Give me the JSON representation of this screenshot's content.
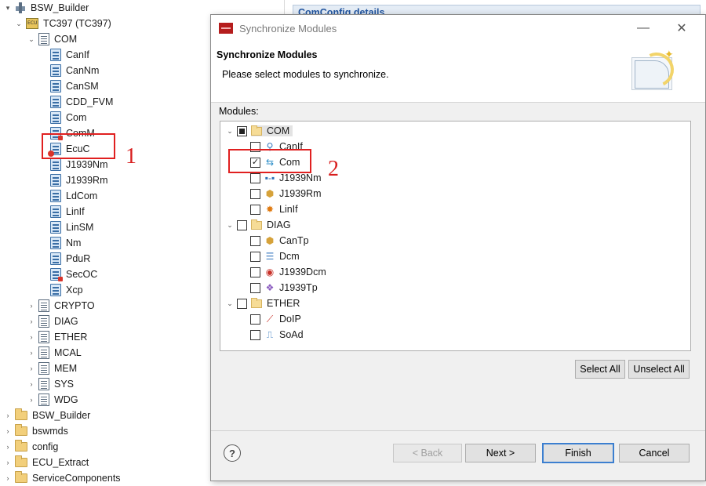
{
  "tree": {
    "items": [
      {
        "label": "BSW_Builder",
        "icon": "project-icon",
        "expanded": true
      },
      {
        "label": "TC397 (TC397)",
        "icon": "ecu-icon",
        "expanded": true
      },
      {
        "label": "COM",
        "icon": "module-list-icon",
        "expanded": true
      },
      {
        "label": "CanIf",
        "icon": "module-file-icon"
      },
      {
        "label": "CanNm",
        "icon": "module-file-icon"
      },
      {
        "label": "CanSM",
        "icon": "module-file-icon"
      },
      {
        "label": "CDD_FVM",
        "icon": "module-file-icon"
      },
      {
        "label": "Com",
        "icon": "module-file-icon"
      },
      {
        "label": "ComM",
        "icon": "module-file-icon"
      },
      {
        "label": "EcuC",
        "icon": "module-file-icon"
      },
      {
        "label": "J1939Nm",
        "icon": "module-file-icon"
      },
      {
        "label": "J1939Rm",
        "icon": "module-file-icon"
      },
      {
        "label": "LdCom",
        "icon": "module-file-icon"
      },
      {
        "label": "LinIf",
        "icon": "module-file-icon"
      },
      {
        "label": "LinSM",
        "icon": "module-file-icon"
      },
      {
        "label": "Nm",
        "icon": "module-file-icon"
      },
      {
        "label": "PduR",
        "icon": "module-file-icon"
      },
      {
        "label": "SecOC",
        "icon": "module-file-icon"
      },
      {
        "label": "Xcp",
        "icon": "module-file-icon"
      },
      {
        "label": "CRYPTO",
        "icon": "module-list-icon"
      },
      {
        "label": "DIAG",
        "icon": "module-list-icon"
      },
      {
        "label": "ETHER",
        "icon": "module-list-icon"
      },
      {
        "label": "MCAL",
        "icon": "module-list-icon"
      },
      {
        "label": "MEM",
        "icon": "module-list-icon"
      },
      {
        "label": "SYS",
        "icon": "module-list-icon"
      },
      {
        "label": "WDG",
        "icon": "module-list-icon"
      },
      {
        "label": "BSW_Builder",
        "icon": "folder-icon"
      },
      {
        "label": "bswmds",
        "icon": "folder-icon"
      },
      {
        "label": "config",
        "icon": "folder-icon"
      },
      {
        "label": "ECU_Extract",
        "icon": "folder-icon"
      },
      {
        "label": "ServiceComponents",
        "icon": "folder-icon"
      }
    ]
  },
  "annotations": {
    "one": "1",
    "two": "2"
  },
  "background_editor": {
    "title": "ComConfig details"
  },
  "dialog": {
    "window_title": "Synchronize Modules",
    "header_title": "Synchronize Modules",
    "header_subtitle": "Please select modules to synchronize.",
    "modules_label": "Modules:",
    "groups": [
      {
        "label": "COM",
        "state": "partial",
        "items": [
          {
            "label": "CanIf",
            "checked": false,
            "icon": "network-icon"
          },
          {
            "label": "Com",
            "checked": true,
            "icon": "com-icon"
          },
          {
            "label": "J1939Nm",
            "checked": false,
            "icon": "node-link-icon"
          },
          {
            "label": "J1939Rm",
            "checked": false,
            "icon": "package-icon"
          },
          {
            "label": "LinIf",
            "checked": false,
            "icon": "spark-icon"
          }
        ]
      },
      {
        "label": "DIAG",
        "state": "unchecked",
        "items": [
          {
            "label": "CanTp",
            "checked": false,
            "icon": "package-icon"
          },
          {
            "label": "Dcm",
            "checked": false,
            "icon": "database-icon"
          },
          {
            "label": "J1939Dcm",
            "checked": false,
            "icon": "target-icon"
          },
          {
            "label": "J1939Tp",
            "checked": false,
            "icon": "molecule-icon"
          }
        ]
      },
      {
        "label": "ETHER",
        "state": "unchecked",
        "items": [
          {
            "label": "DoIP",
            "checked": false,
            "icon": "chart-link-icon"
          },
          {
            "label": "SoAd",
            "checked": false,
            "icon": "socket-icon"
          }
        ]
      }
    ],
    "buttons": {
      "select_all": "Select All",
      "unselect_all": "Unselect All",
      "back": "< Back",
      "next": "Next >",
      "finish": "Finish",
      "cancel": "Cancel",
      "help": "?"
    },
    "window_controls": {
      "minimize": "—",
      "maximize": "☐",
      "close": "✕"
    }
  },
  "colors": {
    "highlight": "#e02020",
    "accent": "#3c7fd0"
  }
}
